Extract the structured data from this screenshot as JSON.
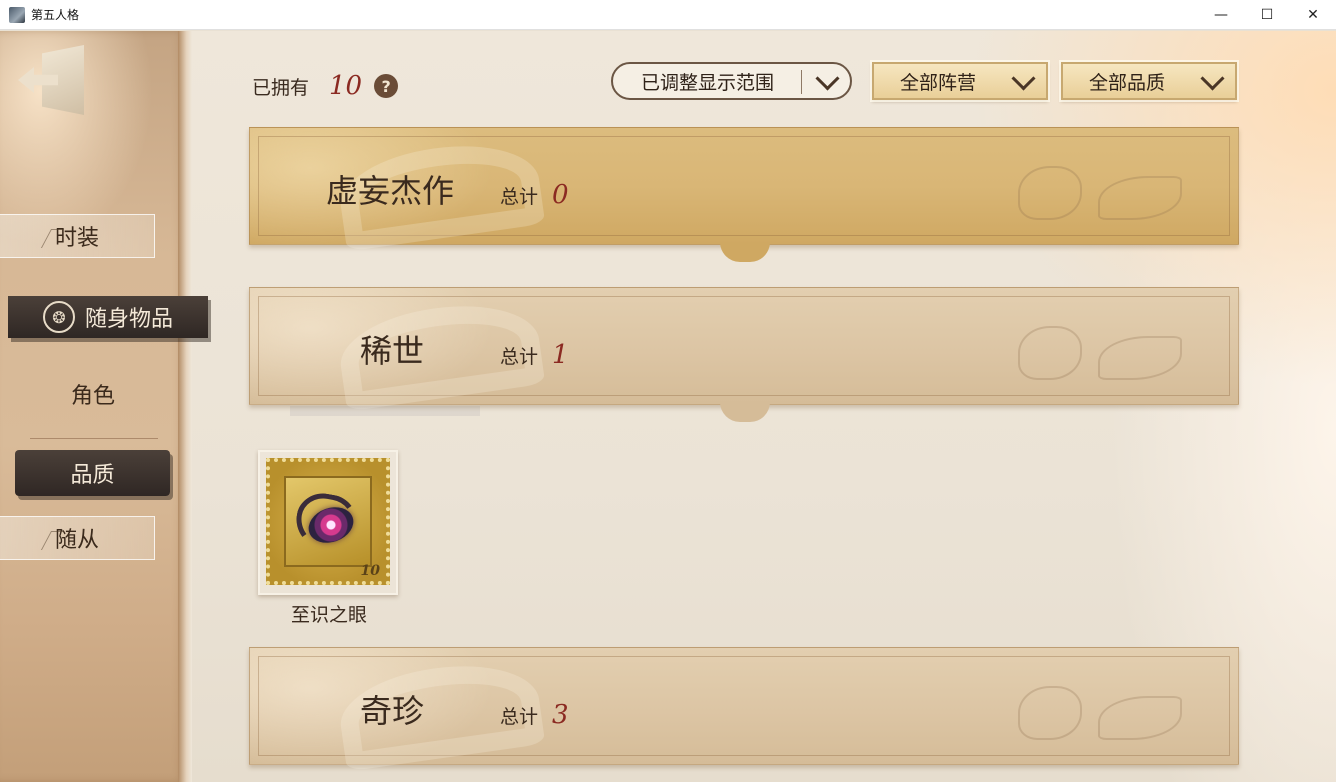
{
  "window": {
    "title": "第五人格",
    "minimize": "—",
    "maximize": "☐",
    "close": "✕"
  },
  "sidebar": {
    "items": [
      {
        "label": "时装",
        "style": "plain"
      },
      {
        "label": "随身物品",
        "style": "selected",
        "icon": "shield-emblem-icon"
      },
      {
        "label": "角色",
        "style": "text"
      },
      {
        "label": "品质",
        "style": "selected-filter"
      },
      {
        "label": "随从",
        "style": "plain"
      }
    ]
  },
  "header": {
    "owned_label": "已拥有",
    "owned_count": "10",
    "help": "?",
    "range_dropdown": "已调整显示范围",
    "faction_dropdown": "全部阵营",
    "quality_dropdown": "全部品质"
  },
  "categories": [
    {
      "name": "虚妄杰作",
      "total_label": "总计",
      "total": "0",
      "color": "#d9b676"
    },
    {
      "name": "稀世",
      "total_label": "总计",
      "total": "1",
      "color": "#dcc5a4"
    },
    {
      "name": "奇珍",
      "total_label": "总计",
      "total": "3",
      "color": "#dcc5a4"
    }
  ],
  "items": [
    {
      "name": "至识之眼",
      "value": "10",
      "icon": "eye-accessory-icon"
    }
  ],
  "colors": {
    "accent_red": "#8b2a22",
    "text_dark": "#3a2a1e",
    "gold_banner": "#d9b676",
    "tan_banner": "#dcc5a4"
  }
}
